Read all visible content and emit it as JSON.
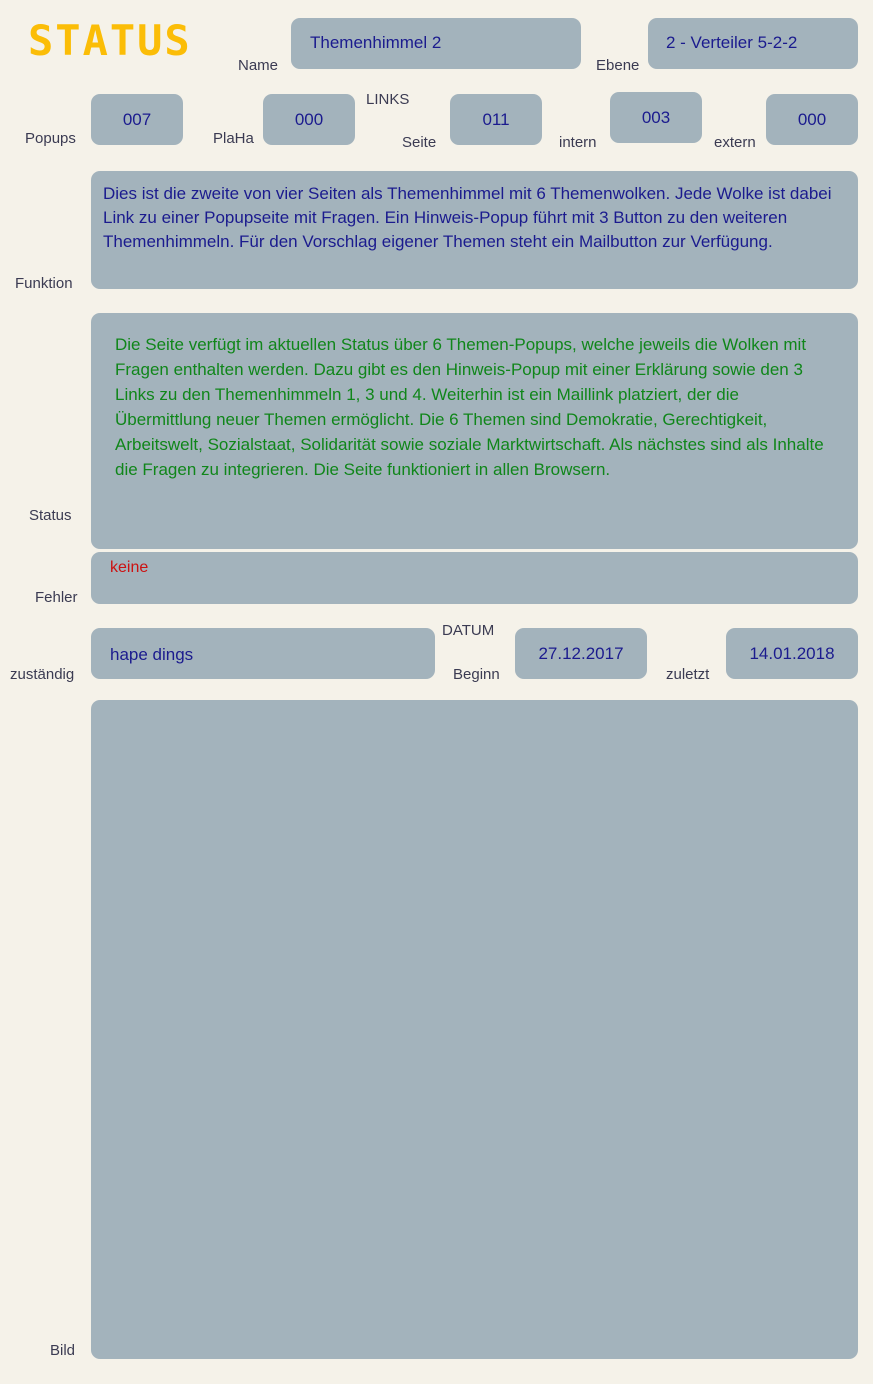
{
  "app": {
    "title": "STATUS",
    "title_color": "#fbbd07",
    "background_color": "#f5f2e9",
    "panel_color": "#a3b3bc",
    "value_color": "#1b1b8e",
    "label_color": "#3b3b52",
    "error_color": "#cc1111",
    "status_color": "#10861a"
  },
  "header": {
    "name_label": "Name",
    "name_value": "Themenhimmel 2",
    "ebene_label": "Ebene",
    "ebene_value": "2 - Verteiler 5-2-2"
  },
  "counters": {
    "links_group_label": "LINKS",
    "popups_label": "Popups",
    "popups_value": "007",
    "plaha_label": "PlaHa",
    "plaha_value": "000",
    "seite_label": "Seite",
    "seite_value": "011",
    "intern_label": "intern",
    "intern_value": "003",
    "extern_label": "extern",
    "extern_value": "000"
  },
  "funktion": {
    "label": "Funktion",
    "text": "Dies ist die zweite von vier Seiten als Themenhimmel mit 6 Themenwolken. Jede Wolke ist dabei Link zu einer Popupseite mit Fragen. Ein Hinweis-Popup führt mit 3 Button zu den weiteren Themenhimmeln. Für den Vorschlag eigener Themen steht ein Mailbutton zur Verfügung."
  },
  "status": {
    "label": "Status",
    "text": "Die Seite verfügt im aktuellen Status über 6 Themen-Popups, welche jeweils die Wolken mit Fragen enthalten werden. Dazu gibt es den Hinweis-Popup mit einer Erklärung sowie den 3 Links zu den Themenhimmeln 1, 3 und 4. Weiterhin ist ein Maillink platziert, der die Übermittlung neuer Themen ermöglicht. Die 6 Themen sind Demokratie, Gerechtigkeit, Arbeitswelt, Sozialstaat, Solidarität sowie soziale Marktwirtschaft. Als nächstes sind als Inhalte die Fragen zu integrieren. Die Seite funktioniert in allen Browsern."
  },
  "fehler": {
    "label": "Fehler",
    "text": "keine"
  },
  "responsible": {
    "label": "zuständig",
    "value": "hape dings",
    "datum_group_label": "DATUM",
    "beginn_label": "Beginn",
    "beginn_value": "27.12.2017",
    "zuletzt_label": "zuletzt",
    "zuletzt_value": "14.01.2018"
  },
  "bild": {
    "label": "Bild",
    "value": ""
  }
}
